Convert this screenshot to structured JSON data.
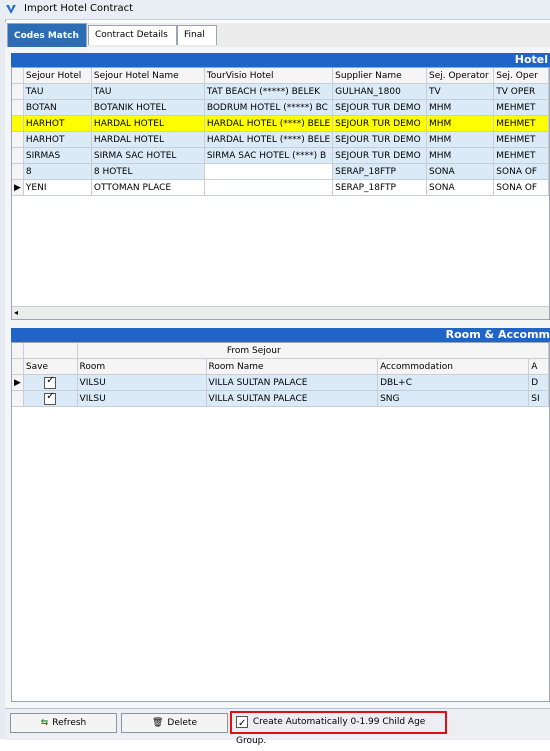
{
  "window": {
    "title": "Import Hotel Contract"
  },
  "tabs": [
    {
      "label": "Codes Match",
      "active": true
    },
    {
      "label": "Contract Details",
      "active": false
    },
    {
      "label": "Final",
      "active": false
    }
  ],
  "hotels": {
    "header": "Hotel",
    "columns": [
      "Sejour Hotel",
      "Sejour Hotel Name",
      "TourVisio Hotel",
      "Supplier Name",
      "Sej. Operator",
      "Sej. Oper"
    ],
    "rows": [
      {
        "indicator": "",
        "cells": [
          "TAU",
          "TAU",
          "TAT BEACH (*****) BELEK",
          "GULHAN_1800",
          "TV",
          "TV OPER"
        ]
      },
      {
        "indicator": "",
        "cells": [
          "BOTAN",
          "BOTANIK HOTEL",
          "BODRUM HOTEL (*****) BC",
          "SEJOUR TUR DEMO",
          "MHM",
          "MEHMET"
        ]
      },
      {
        "indicator": "",
        "cells": [
          "HARHOT",
          "HARDAL HOTEL",
          "HARDAL HOTEL (****) BELE",
          "SEJOUR TUR DEMO",
          "MHM",
          "MEHMET"
        ]
      },
      {
        "indicator": "",
        "cells": [
          "HARHOT",
          "HARDAL HOTEL",
          "HARDAL HOTEL (****) BELE",
          "SEJOUR TUR DEMO",
          "MHM",
          "MEHMET"
        ]
      },
      {
        "indicator": "",
        "cells": [
          "SIRMAS",
          "SIRMA SAC HOTEL",
          "SIRMA SAC HOTEL (****) B",
          "SEJOUR TUR DEMO",
          "MHM",
          "MEHMET"
        ]
      },
      {
        "indicator": "",
        "cells": [
          "8",
          "8 HOTEL",
          "",
          "SERAP_18FTP",
          "SONA",
          "SONA OF"
        ]
      },
      {
        "indicator": "▶",
        "cells": [
          "YENI",
          "OTTOMAN PLACE",
          "",
          "SERAP_18FTP",
          "SONA",
          "SONA OF"
        ]
      }
    ]
  },
  "rooms": {
    "header": "Room & Accomm",
    "group_header": "From Sejour",
    "columns": [
      "Save",
      "Room",
      "Room Name",
      "Accommodation",
      "A"
    ],
    "rows": [
      {
        "indicator": "▶",
        "save": true,
        "cells": [
          "VILSU",
          "VILLA SULTAN PALACE",
          "DBL+C",
          "D"
        ]
      },
      {
        "indicator": "",
        "save": true,
        "cells": [
          "VILSU",
          "VILLA SULTAN PALACE",
          "SNG",
          "SI"
        ]
      }
    ]
  },
  "footer": {
    "refresh_label": "Refresh",
    "delete_label": "Delete",
    "child_age_label": "Create Automatically 0-1.99 Child Age Group.",
    "child_age_checked": true
  }
}
